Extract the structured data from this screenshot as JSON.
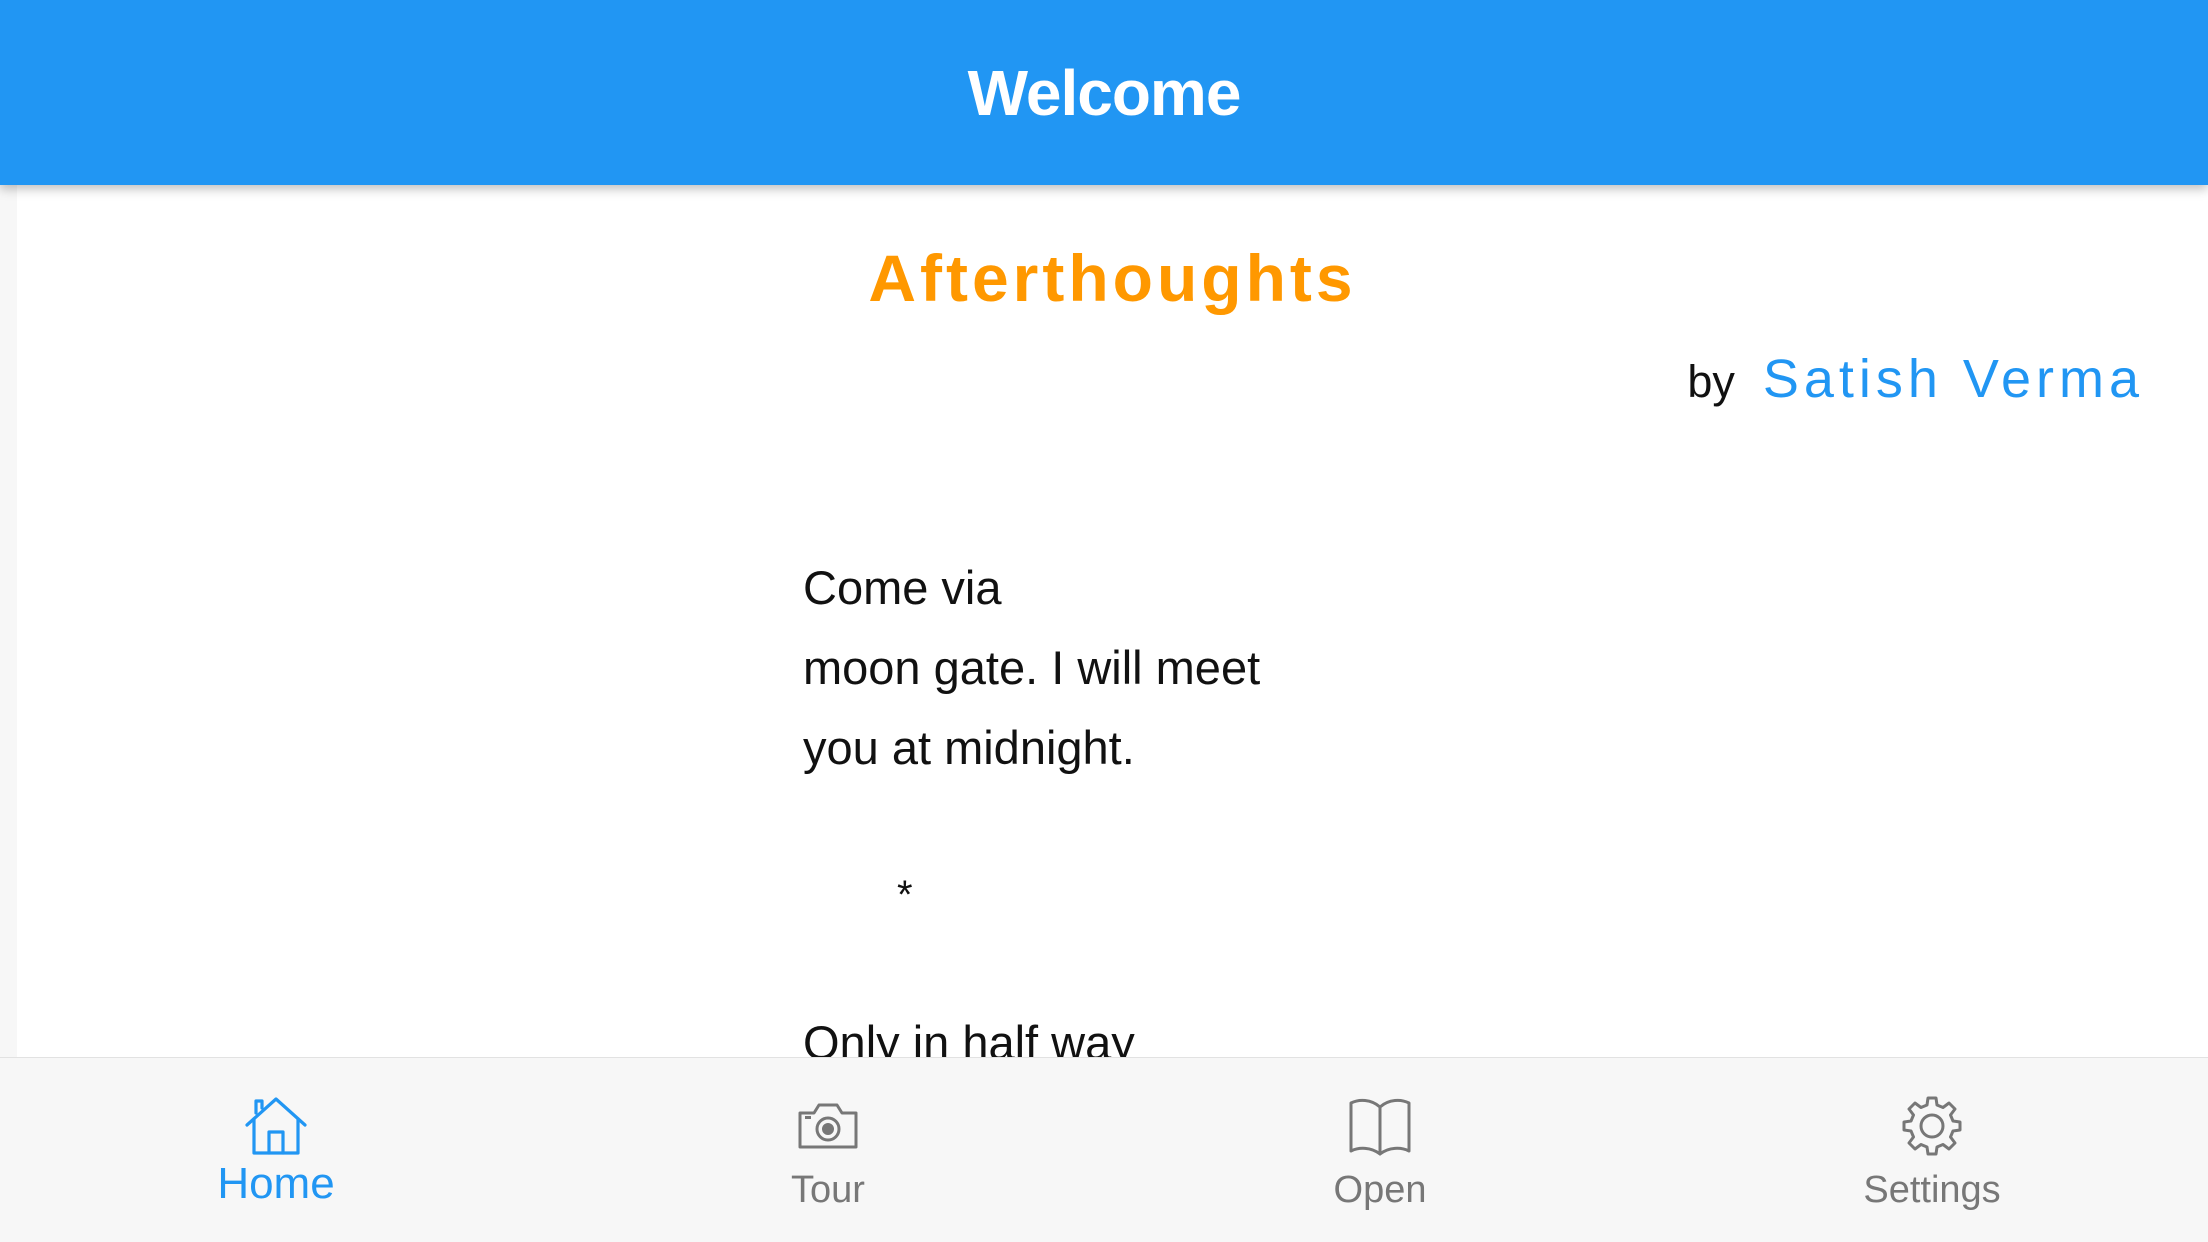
{
  "navbar": {
    "title": "Welcome"
  },
  "poem": {
    "title": "Afterthoughts",
    "by_label": "by",
    "author": "Satish Verma",
    "lines": [
      "Come via",
      "moon gate. I will meet",
      "you at midnight."
    ],
    "separator": "*",
    "partial_line": "Only in half way"
  },
  "tabs": [
    {
      "label": "Home",
      "icon": "home-icon",
      "active": true
    },
    {
      "label": "Tour",
      "icon": "camera-icon",
      "active": false
    },
    {
      "label": "Open",
      "icon": "book-icon",
      "active": false
    },
    {
      "label": "Settings",
      "icon": "gear-icon",
      "active": false
    }
  ],
  "colors": {
    "primary": "#2196f3",
    "accent": "#ff9800",
    "text": "#111111",
    "tab_inactive": "#777777"
  }
}
